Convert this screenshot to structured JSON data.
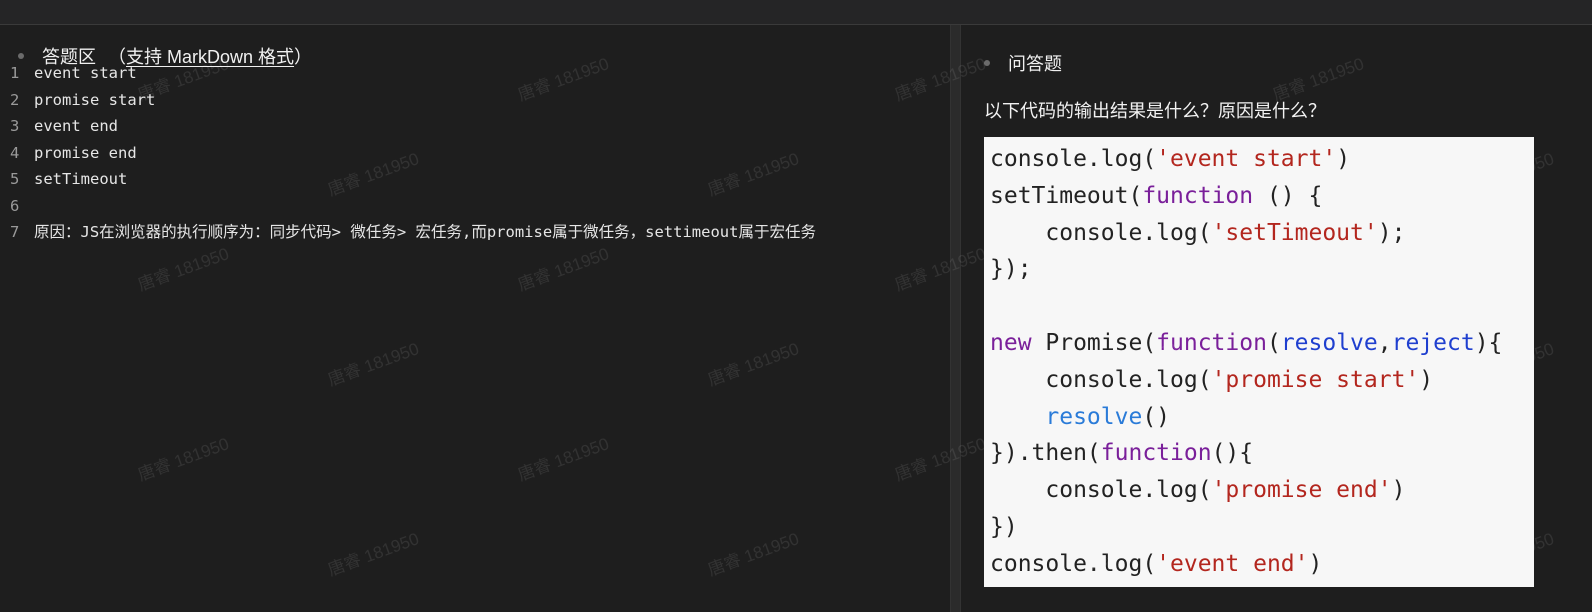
{
  "answer_area": {
    "title": "答题区",
    "paren_open": "（",
    "markdown_hint": "支持 MarkDown 格式",
    "paren_close": "）",
    "lines": [
      {
        "num": "1",
        "text": "event start"
      },
      {
        "num": "2",
        "text": "promise start"
      },
      {
        "num": "3",
        "text": "event end"
      },
      {
        "num": "4",
        "text": "promise end"
      },
      {
        "num": "5",
        "text": "setTimeout"
      },
      {
        "num": "6",
        "text": ""
      },
      {
        "num": "7",
        "text": "原因：JS在浏览器的执行顺序为：同步代码> 微任务> 宏任务,而promise属于微任务，settimeout属于宏任务"
      }
    ]
  },
  "question_area": {
    "title": "问答题",
    "question": "以下代码的输出结果是什么？原因是什么？"
  },
  "code": {
    "l1": {
      "a": "console.log(",
      "s": "'event start'",
      "c": ")"
    },
    "l2": {
      "a": "setTimeout(",
      "k": "function",
      "c": " () {"
    },
    "l3": {
      "a": "    console.log(",
      "s": "'setTimeout'",
      "c": ");"
    },
    "l4": {
      "a": "});"
    },
    "l5": {
      "k": "new",
      "a": " Promise(",
      "k2": "function",
      "p": "(",
      "b1": "resolve",
      "comma": ",",
      "b2": "reject",
      "c": "){"
    },
    "l6": {
      "a": "    console.log(",
      "s": "'promise start'",
      "c": ")"
    },
    "l7": {
      "pre": "    ",
      "bb": "resolve",
      "c": "()"
    },
    "l8": {
      "a": "}).then(",
      "k": "function",
      "c": "(){"
    },
    "l9": {
      "a": "    console.log(",
      "s": "'promise end'",
      "c": ")"
    },
    "l10": {
      "a": "})"
    },
    "l11": {
      "a": "console.log(",
      "s": "'event end'",
      "c": ")"
    }
  },
  "watermark": "唐睿 181950"
}
